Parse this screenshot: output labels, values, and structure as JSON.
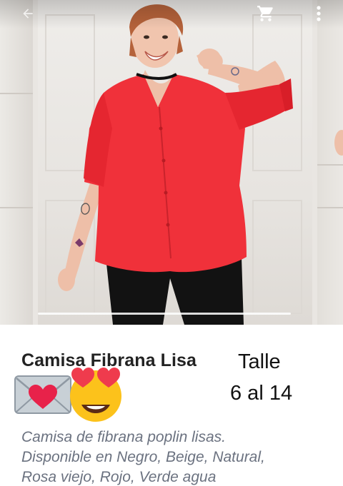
{
  "toolbar": {
    "back_icon": "arrow-back-icon",
    "cart_icon": "shopping-cart-icon",
    "menu_icon": "more-vert-icon"
  },
  "gallery": {
    "main_image": "woman-wearing-red-button-up-blouse",
    "colors": {
      "blouse": "#f0313a",
      "pants": "#111111",
      "wall": "#ebe8e4"
    }
  },
  "product": {
    "title": "Camisa Fibrana Lisa",
    "size_label": "Talle",
    "size_range": "6 al 14",
    "emojis": [
      "love-letter-emoji",
      "heart-eyes-emoji"
    ],
    "description_lines": [
      "Camisa de fibrana poplin lisas.",
      "Disponible en Negro, Beige, Natural,",
      "Rosa viejo, Rojo, Verde agua"
    ]
  }
}
